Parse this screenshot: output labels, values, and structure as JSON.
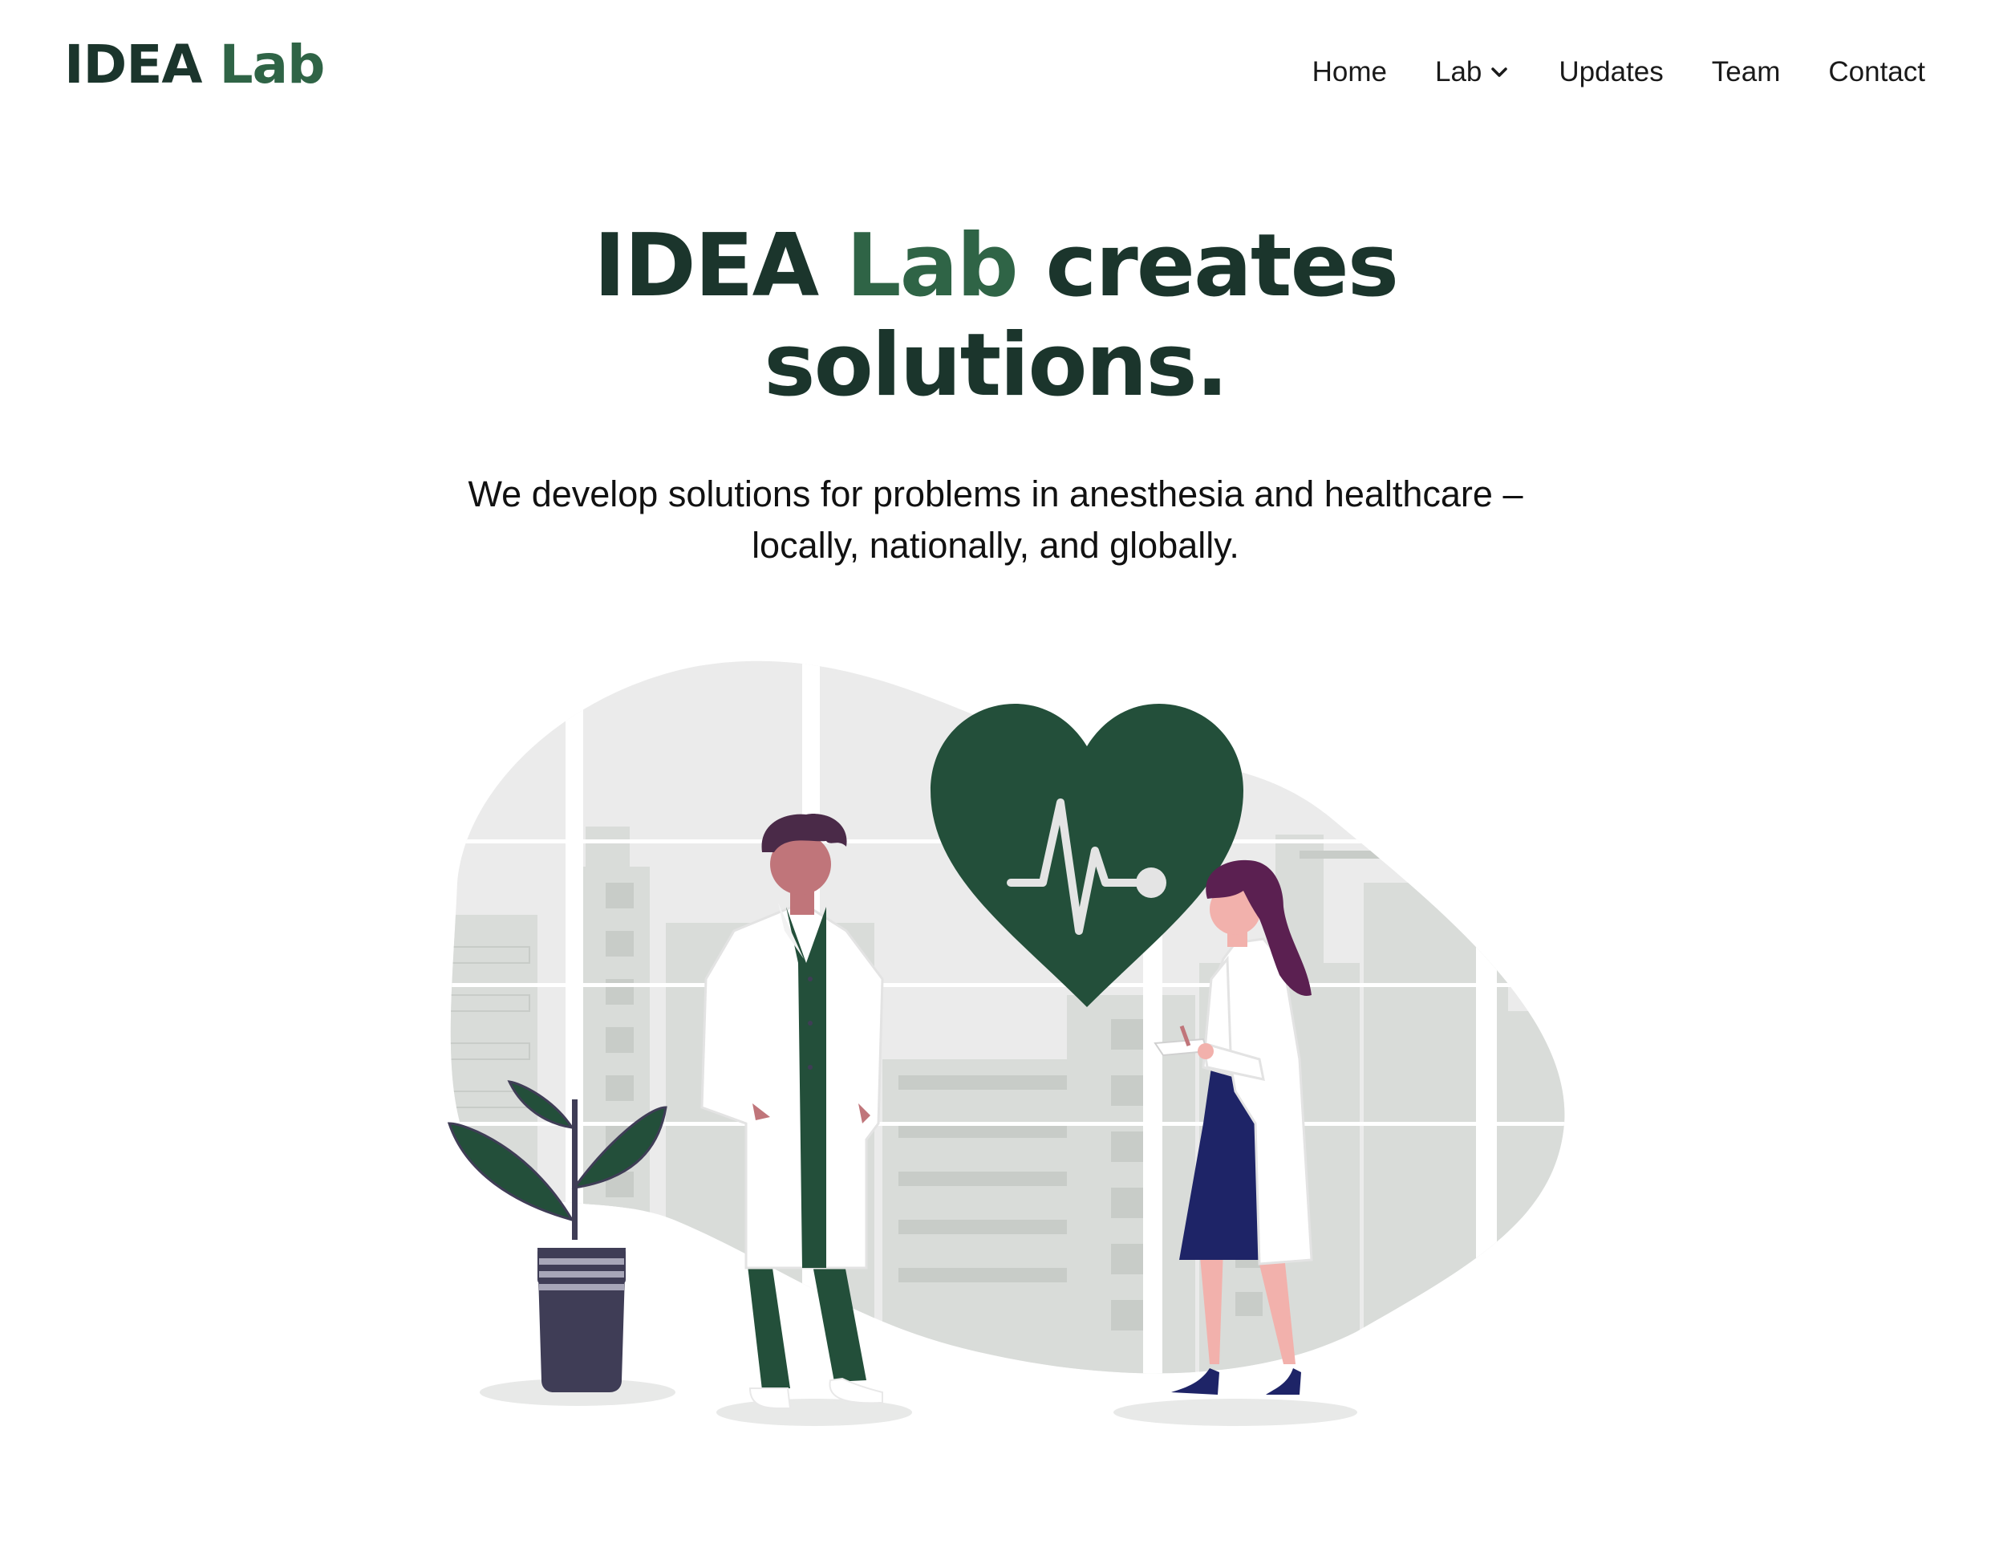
{
  "header": {
    "logo_primary": "IDEA",
    "logo_accent": "Lab",
    "nav": [
      {
        "label": "Home"
      },
      {
        "label": "Lab",
        "has_dropdown": true
      },
      {
        "label": "Updates"
      },
      {
        "label": "Team"
      },
      {
        "label": "Contact"
      }
    ]
  },
  "hero": {
    "title_primary": "IDEA",
    "title_accent": "Lab",
    "title_rest_line1": "creates",
    "title_line2": "solutions.",
    "subtitle_line1": "We develop solutions for problems in anesthesia and healthcare –",
    "subtitle_line2": "locally, nationally, and globally."
  },
  "colors": {
    "dark_green": "#1b352c",
    "accent_green": "#2f6446",
    "heart_green": "#234f3a",
    "text": "#1a1a1a"
  },
  "icons": {
    "dropdown": "chevron-down-icon"
  }
}
